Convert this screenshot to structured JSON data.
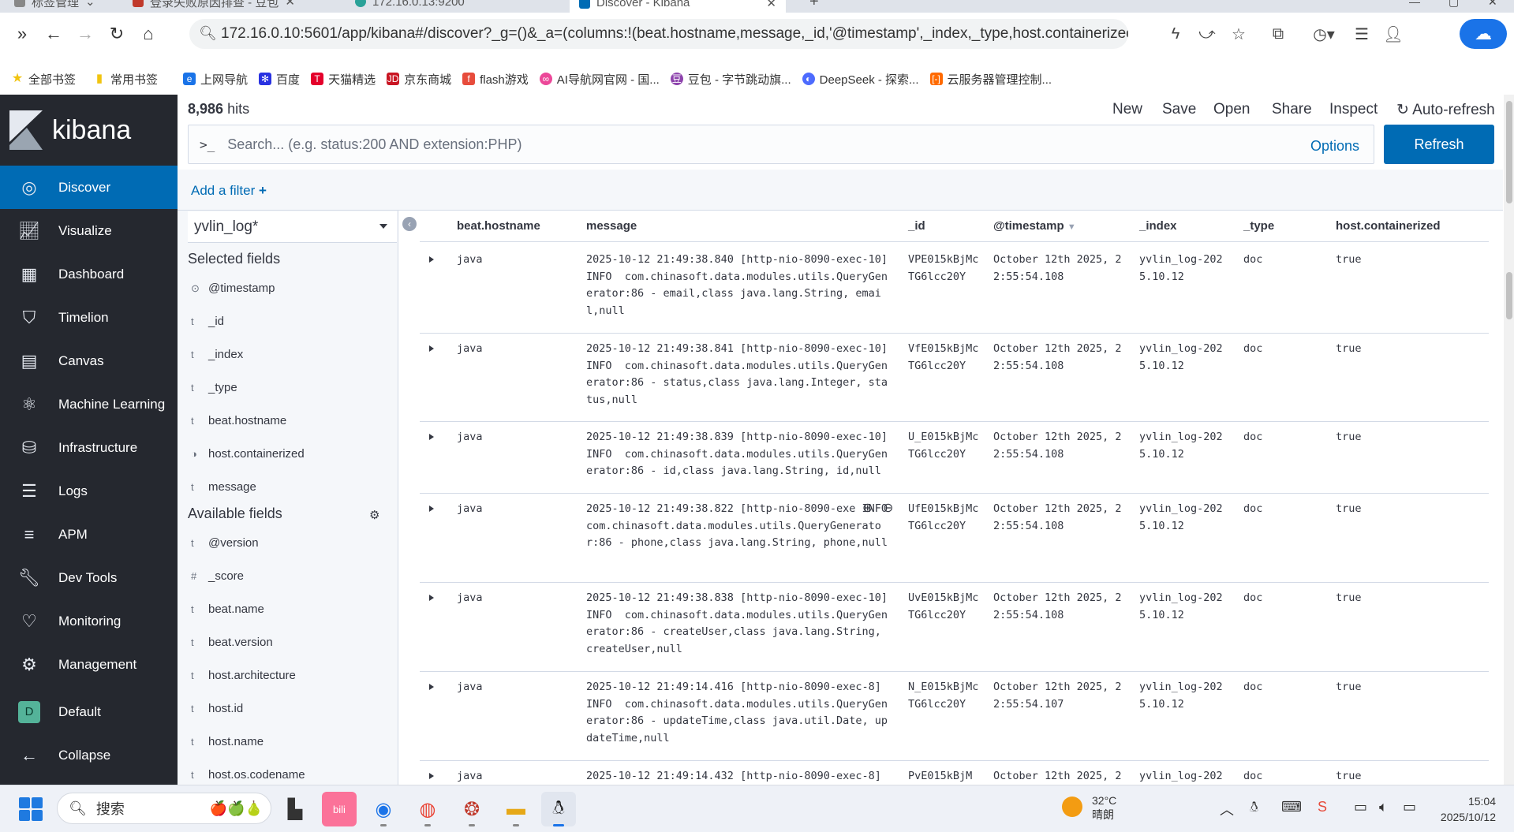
{
  "browser": {
    "tabs": [
      "标签管理",
      "登录失败原因排查 - 豆包",
      "172.16.0.13:9200",
      "Discover - Kibana"
    ],
    "new_tab": "+",
    "url": "172.16.0.10:5601/app/kibana#/discover?_g=()&_a=(columns:!(beat.hostname,message,_id,'@timestamp',_index,_type,host.containerized),i",
    "bookmarks": [
      "全部书签",
      "常用书签",
      "上网导航",
      "百度",
      "天猫精选",
      "京东商城",
      "flash游戏",
      "AI导航网官网 - 国...",
      "豆包 - 字节跳动旗...",
      "DeepSeek - 探索...",
      "云服务器管理控制..."
    ]
  },
  "kibana": {
    "logo_text": "kibana",
    "nav": [
      {
        "label": "Discover",
        "icon": "compass-icon"
      },
      {
        "label": "Visualize",
        "icon": "chart-icon"
      },
      {
        "label": "Dashboard",
        "icon": "dashboard-icon"
      },
      {
        "label": "Timelion",
        "icon": "shield-icon"
      },
      {
        "label": "Canvas",
        "icon": "canvas-icon"
      },
      {
        "label": "Machine Learning",
        "icon": "ml-icon"
      },
      {
        "label": "Infrastructure",
        "icon": "infra-icon"
      },
      {
        "label": "Logs",
        "icon": "logs-icon"
      },
      {
        "label": "APM",
        "icon": "apm-icon"
      },
      {
        "label": "Dev Tools",
        "icon": "wrench-icon"
      },
      {
        "label": "Monitoring",
        "icon": "heartbeat-icon"
      },
      {
        "label": "Management",
        "icon": "gear-icon"
      }
    ],
    "space": {
      "badge": "D",
      "label": "Default"
    },
    "collapse": "Collapse",
    "hits_count": "8,986",
    "hits_label": "hits",
    "top_menu": [
      "New",
      "Save",
      "Open",
      "Share",
      "Inspect",
      "Auto-refresh"
    ],
    "query_placeholder": "Search... (e.g. status:200 AND extension:PHP)",
    "query_prompt": ">_",
    "options": "Options",
    "refresh": "Refresh",
    "add_filter": "Add a filter",
    "index_pattern": "yvlin_log*",
    "selected_fields_title": "Selected fields",
    "selected_fields": [
      {
        "type": "⊙",
        "name": "@timestamp"
      },
      {
        "type": "t",
        "name": "_id"
      },
      {
        "type": "t",
        "name": "_index"
      },
      {
        "type": "t",
        "name": "_type"
      },
      {
        "type": "t",
        "name": "beat.hostname"
      },
      {
        "type": "◑",
        "name": "host.containerized"
      },
      {
        "type": "t",
        "name": "message"
      }
    ],
    "available_fields_title": "Available fields",
    "available_fields": [
      {
        "type": "t",
        "name": "@version"
      },
      {
        "type": "#",
        "name": "_score"
      },
      {
        "type": "t",
        "name": "beat.name"
      },
      {
        "type": "t",
        "name": "beat.version"
      },
      {
        "type": "t",
        "name": "host.architecture"
      },
      {
        "type": "t",
        "name": "host.id"
      },
      {
        "type": "t",
        "name": "host.name"
      },
      {
        "type": "t",
        "name": "host.os.codename"
      }
    ],
    "columns": [
      "beat.hostname",
      "message",
      "_id",
      "@timestamp",
      "_index",
      "_type",
      "host.containerized"
    ],
    "rows": [
      {
        "host": "java",
        "message": "2025-10-12 21:49:38.840 [http-nio-8090-exec-10] INFO  com.chinasoft.data.modules.utils.QueryGenerator:86 - email,class java.lang.String, email,null",
        "id": "VPE015kBjMcTG6lcc20Y",
        "timestamp": "October 12th 2025, 22:55:54.108",
        "index": "yvlin_log-2025.10.12",
        "type": "doc",
        "containerized": "true"
      },
      {
        "host": "java",
        "message": "2025-10-12 21:49:38.841 [http-nio-8090-exec-10] INFO  com.chinasoft.data.modules.utils.QueryGenerator:86 - status,class java.lang.Integer, status,null",
        "id": "VfE015kBjMcTG6lcc20Y",
        "timestamp": "October 12th 2025, 22:55:54.108",
        "index": "yvlin_log-2025.10.12",
        "type": "doc",
        "containerized": "true"
      },
      {
        "host": "java",
        "message": "2025-10-12 21:49:38.839 [http-nio-8090-exec-10] INFO  com.chinasoft.data.modules.utils.QueryGenerator:86 - id,class java.lang.String, id,null",
        "id": "U_E015kBjMcTG6lcc20Y",
        "timestamp": "October 12th 2025, 22:55:54.108",
        "index": "yvlin_log-2025.10.12",
        "type": "doc",
        "containerized": "true"
      },
      {
        "host": "java",
        "message": "2025-10-12 21:49:38.822 [http-nio-8090-exe INFO  com.chinasoft.data.modules.utils.QueryGenerator:86 - phone,class java.lang.String, phone,null",
        "id": "UfE015kBjMcTG6lcc20Y",
        "timestamp": "October 12th 2025, 22:55:54.108",
        "index": "yvlin_log-2025.10.12",
        "type": "doc",
        "containerized": "true"
      },
      {
        "host": "java",
        "message": "2025-10-12 21:49:38.838 [http-nio-8090-exec-10] INFO  com.chinasoft.data.modules.utils.QueryGenerator:86 - createUser,class java.lang.String, createUser,null",
        "id": "UvE015kBjMcTG6lcc20Y",
        "timestamp": "October 12th 2025, 22:55:54.108",
        "index": "yvlin_log-2025.10.12",
        "type": "doc",
        "containerized": "true"
      },
      {
        "host": "java",
        "message": "2025-10-12 21:49:14.416 [http-nio-8090-exec-8] INFO  com.chinasoft.data.modules.utils.QueryGenerator:86 - updateTime,class java.util.Date, updateTime,null",
        "id": "N_E015kBjMcTG6lcc20Y",
        "timestamp": "October 12th 2025, 22:55:54.107",
        "index": "yvlin_log-2025.10.12",
        "type": "doc",
        "containerized": "true"
      },
      {
        "host": "java",
        "message": "2025-10-12 21:49:14.432 [http-nio-8090-exec-8]",
        "id": "PvE015kBjM",
        "timestamp": "October 12th 2025, 2",
        "index": "yvlin_log-202",
        "type": "doc",
        "containerized": "true"
      }
    ]
  },
  "taskbar": {
    "search": "搜索",
    "weather_temp": "32°C",
    "weather_desc": "晴朗",
    "time": "15:04",
    "date": "2025/10/12"
  }
}
